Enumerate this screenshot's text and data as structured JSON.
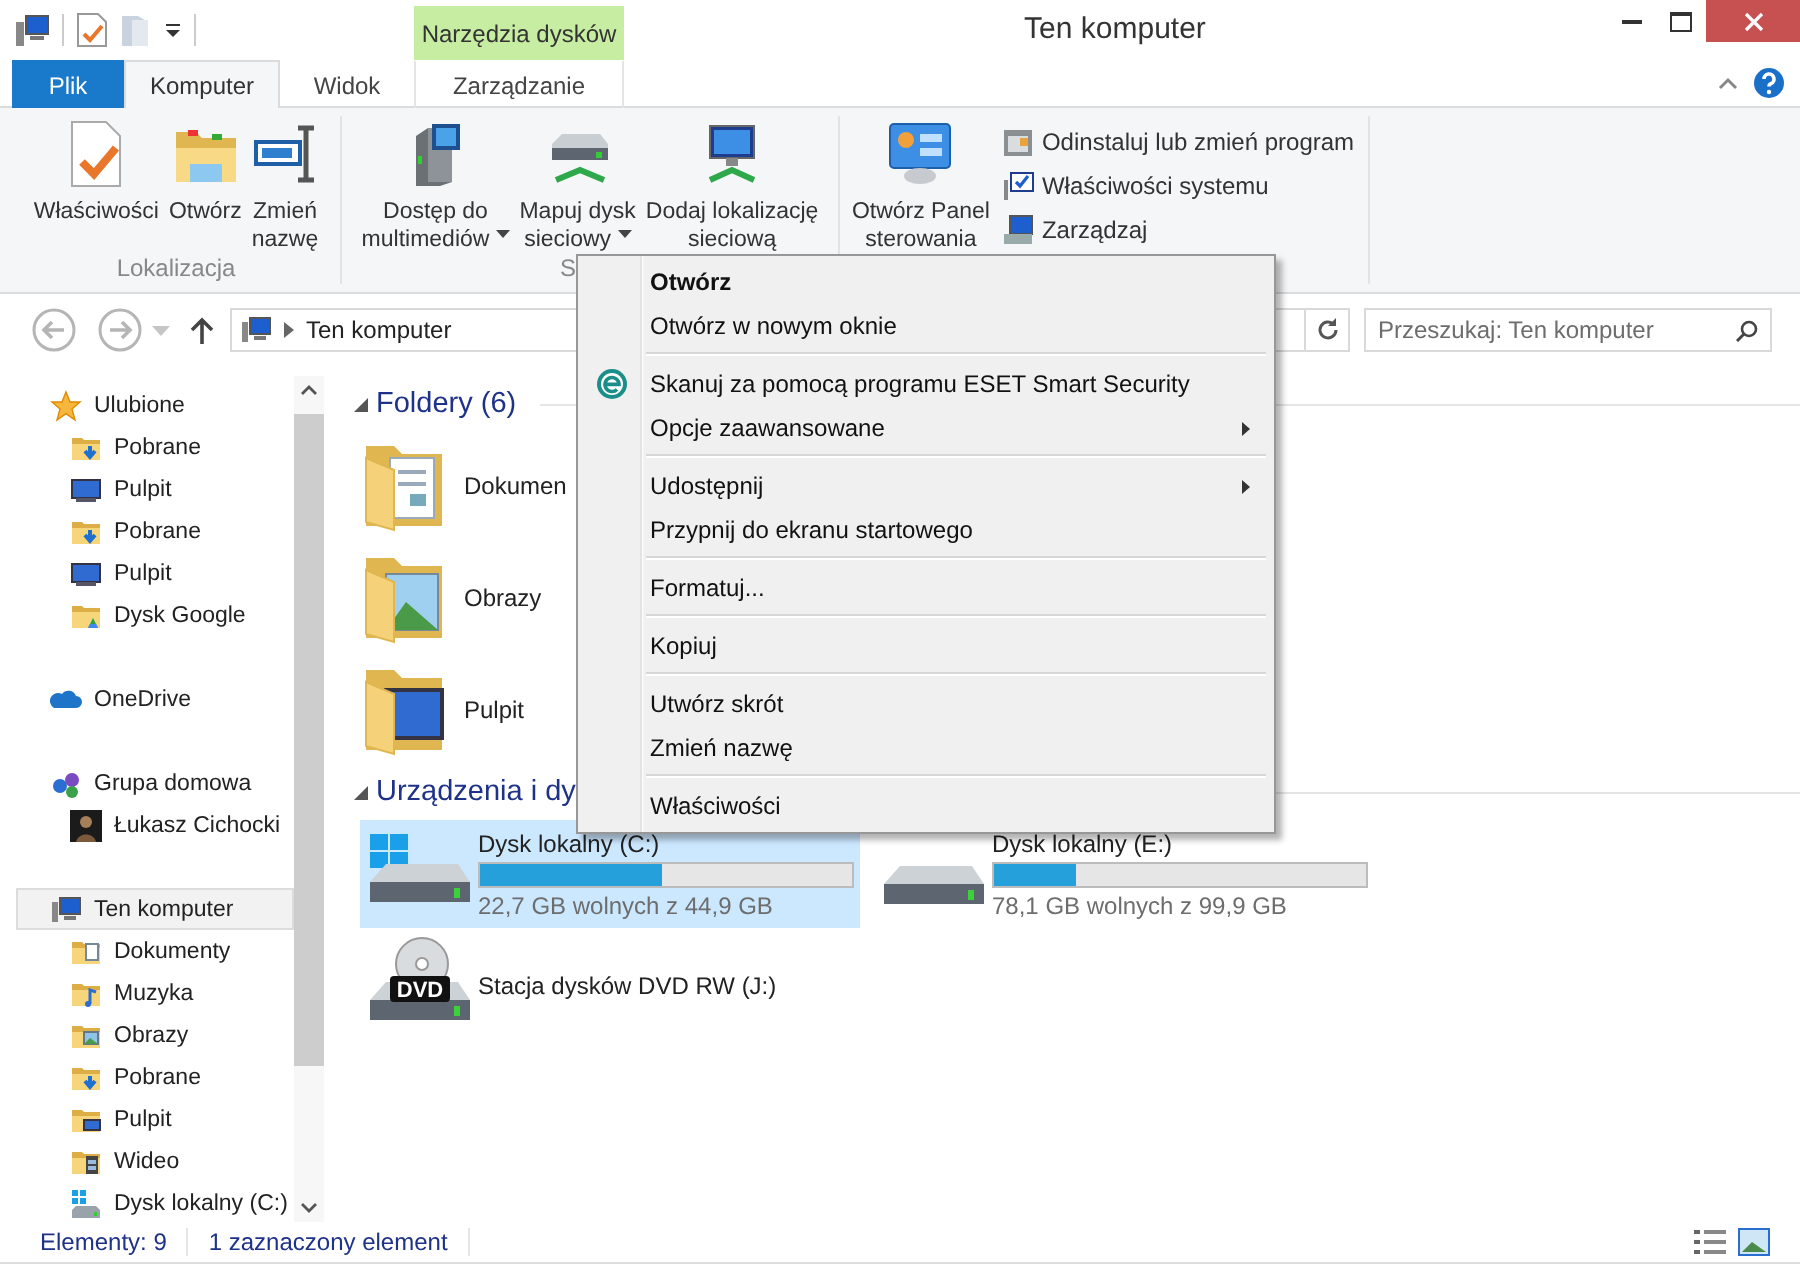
{
  "window": {
    "title": "Ten komputer",
    "context_tab": "Narzędzia dysków"
  },
  "tabs": [
    {
      "label": "Plik",
      "kind": "file",
      "selected": false
    },
    {
      "label": "Komputer",
      "kind": "tab",
      "selected": true
    },
    {
      "label": "Widok",
      "kind": "tab",
      "selected": false
    },
    {
      "label": "Zarządzanie",
      "kind": "contextual",
      "selected": false
    }
  ],
  "ribbon": {
    "groups": [
      {
        "label": "Lokalizacja",
        "buttons": [
          {
            "label": "Właściwości",
            "kind": "large",
            "dropdown": false
          },
          {
            "label": "Otwórz",
            "kind": "large",
            "dropdown": false
          },
          {
            "label": "Zmień\nnazwę",
            "kind": "large",
            "dropdown": false
          }
        ]
      },
      {
        "label": "S",
        "buttons": [
          {
            "label": "Dostęp do\nmultimediów",
            "kind": "large",
            "dropdown": true
          },
          {
            "label": "Mapuj dysk\nsieciowy",
            "kind": "large",
            "dropdown": true
          },
          {
            "label": "Dodaj lokalizację\nsieciową",
            "kind": "large",
            "dropdown": false
          }
        ]
      },
      {
        "buttons": [
          {
            "label": "Otwórz Panel\nsterowania",
            "kind": "large",
            "dropdown": false
          },
          {
            "label": "Odinstaluj lub zmień program",
            "kind": "small",
            "dropdown": false
          },
          {
            "label": "Właściwości systemu",
            "kind": "small",
            "dropdown": false
          },
          {
            "label": "Zarządzaj",
            "kind": "small",
            "dropdown": false
          }
        ]
      }
    ]
  },
  "address": {
    "path": "Ten komputer",
    "search_placeholder": "Przeszukaj: Ten komputer"
  },
  "navigation": [
    {
      "label": "Ulubione",
      "selected": false,
      "children": [
        {
          "label": "Pobrane",
          "selected": false
        },
        {
          "label": "Pulpit",
          "selected": false
        },
        {
          "label": "Pobrane",
          "selected": false
        },
        {
          "label": "Pulpit",
          "selected": false
        },
        {
          "label": "Dysk Google",
          "selected": false
        }
      ]
    },
    {
      "label": "OneDrive",
      "selected": false
    },
    {
      "label": "Grupa domowa",
      "selected": false,
      "children": [
        {
          "label": "Łukasz Cichocki",
          "selected": false
        }
      ]
    },
    {
      "label": "Ten komputer",
      "selected": true,
      "children": [
        {
          "label": "Dokumenty",
          "selected": false
        },
        {
          "label": "Muzyka",
          "selected": false
        },
        {
          "label": "Obrazy",
          "selected": false
        },
        {
          "label": "Pobrane",
          "selected": false
        },
        {
          "label": "Pulpit",
          "selected": false
        },
        {
          "label": "Wideo",
          "selected": false
        },
        {
          "label": "Dysk lokalny (C:)",
          "selected": false
        }
      ]
    }
  ],
  "folders": {
    "title": "Foldery (6)",
    "items": [
      {
        "name": "Dokumen",
        "selected": false
      },
      {
        "name": "Obrazy",
        "selected": false
      },
      {
        "name": "Pulpit",
        "selected": false
      }
    ]
  },
  "devices": {
    "title": "Urządzenia i dy",
    "items": [
      {
        "name": "Dysk lokalny (C:)",
        "kind": "system",
        "level": 0.49,
        "free": "22,7 GB wolnych z 44,9 GB",
        "selected": true
      },
      {
        "name": "Dysk lokalny (E:)",
        "kind": "drive",
        "level": 0.22,
        "free": "78,1 GB wolnych z 99,9 GB",
        "selected": false
      },
      {
        "name": "Stacja dysków DVD RW (J:)",
        "kind": "optical",
        "icon_label": "DVD",
        "selected": false
      }
    ]
  },
  "status_bar": {
    "items": "Elementy: 9",
    "selection": "1 zaznaczony element"
  },
  "context_menu": {
    "groups": [
      [
        {
          "label": "Otwórz",
          "default": true,
          "submenu": false,
          "kind": "plain"
        },
        {
          "label": "Otwórz w nowym oknie",
          "default": false,
          "submenu": false,
          "kind": "plain"
        }
      ],
      [
        {
          "label": "Skanuj za pomocą programu ESET Smart Security",
          "default": false,
          "submenu": false,
          "kind": "antivirus"
        },
        {
          "label": "Opcje zaawansowane",
          "default": false,
          "submenu": true,
          "kind": "plain"
        }
      ],
      [
        {
          "label": "Udostępnij",
          "default": false,
          "submenu": true,
          "kind": "plain"
        },
        {
          "label": "Przypnij do ekranu startowego",
          "default": false,
          "submenu": false,
          "kind": "plain"
        }
      ],
      [
        {
          "label": "Formatuj...",
          "default": false,
          "submenu": false,
          "kind": "plain"
        }
      ],
      [
        {
          "label": "Kopiuj",
          "default": false,
          "submenu": false,
          "kind": "plain"
        }
      ],
      [
        {
          "label": "Utwórz skrót",
          "default": false,
          "submenu": false,
          "kind": "plain"
        },
        {
          "label": "Zmień nazwę",
          "default": false,
          "submenu": false,
          "kind": "plain"
        }
      ],
      [
        {
          "label": "Właściwości",
          "default": false,
          "submenu": false,
          "kind": "plain"
        }
      ]
    ]
  }
}
